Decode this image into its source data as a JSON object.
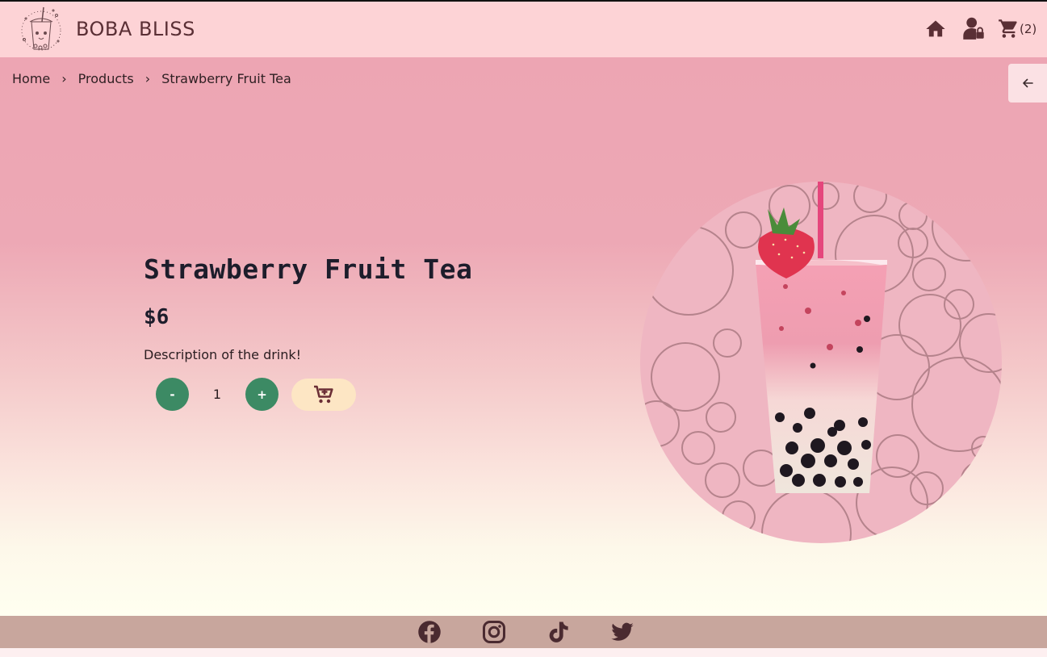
{
  "header": {
    "brand": "BOBA BLISS",
    "cart_count": "(2)"
  },
  "breadcrumb": {
    "items": [
      "Home",
      "Products",
      "Strawberry Fruit Tea"
    ],
    "separator": "›"
  },
  "product": {
    "name": "Strawberry Fruit Tea",
    "price": "$6",
    "description": "Description of the drink!",
    "quantity": "1",
    "decrement_label": "-",
    "increment_label": "+"
  },
  "icons": {
    "home": "home-icon",
    "account": "account-icon",
    "cart": "cart-icon",
    "back": "arrow-left-icon",
    "add_to_cart": "cart-plus-icon",
    "social": [
      "facebook-icon",
      "instagram-icon",
      "tiktok-icon",
      "twitter-icon"
    ]
  },
  "colors": {
    "header_bg": "#fdd3d6",
    "accent_green": "#3c8a64",
    "add_cart_bg": "#fde6c4",
    "footer_bg": "#c8a69d",
    "icon_dark": "#5a2f35"
  }
}
